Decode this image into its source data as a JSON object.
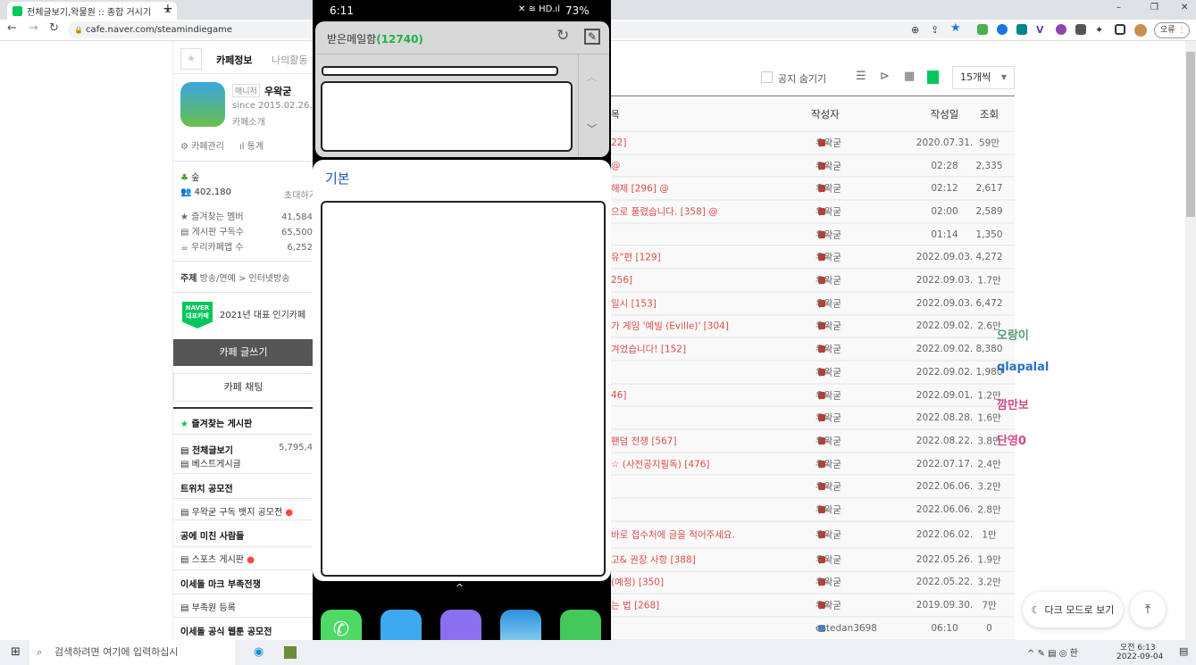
{
  "browser": {
    "tab_title": "전체글보기,왁물원 :: 종합 거시기",
    "new_tab": "+",
    "url": "cafe.naver.com/steamindiegame",
    "profile_label": "오류",
    "window": {
      "min": "–",
      "max": "❐",
      "close": "✕"
    }
  },
  "sidebar": {
    "tab_info": "카페정보",
    "tab_activity": "나의활동",
    "manager_badge": "매니저",
    "manager_name": "우왁굳",
    "since": "since 2015.02.26.",
    "cafe_intro": "카페소개",
    "cafe_manage": "카페관리",
    "stats": "통계",
    "level": "숲",
    "members": "402,180",
    "invite": "초대하기",
    "stats_rows": [
      {
        "label": "즐겨찾는 멤버",
        "value": "41,584"
      },
      {
        "label": "게시판 구독수",
        "value": "65,500"
      },
      {
        "label": "우리카페앱 수",
        "value": "6,252"
      }
    ],
    "topic_label": "주제",
    "topic": "방송/연예 > 인터넷방송",
    "naver_badge": "NAVER 대표카페",
    "award": "2021년 대표 인기카페",
    "write_button": "카페 글쓰기",
    "chat_button": "카페 채팅",
    "fav_boards": "즐겨찾는 게시판",
    "all_posts": "전체글보기",
    "all_posts_count": "5,795,4",
    "best": "베스트게시글",
    "sec1": "트위치 공모전",
    "board1": "우왁굳 구독 뱃지 공모전",
    "sec2": "공에 미친 사람들",
    "board2": "스포츠 게시판",
    "sec3": "이세돌 마크 부족전쟁",
    "board3": "부족원 등록",
    "sec4": "이세돌 공식 웹툰 공모전"
  },
  "toolbar": {
    "hide_notice": "공지 숨기기",
    "per_page": "15개씩"
  },
  "table": {
    "headers": {
      "title": "목",
      "author": "작성자",
      "date": "작성일",
      "views": "조회"
    },
    "rows": [
      {
        "title": "22]",
        "author": "우왁굳",
        "date": "2020.07.31.",
        "views": "59만"
      },
      {
        "title": "@",
        "author": "우왁굳",
        "date": "02:28",
        "views": "2,335"
      },
      {
        "title": "해제 [296] @",
        "author": "우왁굳",
        "date": "02:12",
        "views": "2,617"
      },
      {
        "title": "으로 풀렸습니다. [358] @",
        "author": "우왁굳",
        "date": "02:00",
        "views": "2,589"
      },
      {
        "title": "",
        "author": "우왁굳",
        "date": "01:14",
        "views": "1,350"
      },
      {
        "title": "유\"편 [129]",
        "author": "우왁굳",
        "date": "2022.09.03.",
        "views": "4,272"
      },
      {
        "title": "256]",
        "author": "우왁굳",
        "date": "2022.09.03.",
        "views": "1.7만"
      },
      {
        "title": "일시 [153]",
        "author": "우왁굳",
        "date": "2022.09.03.",
        "views": "6,472"
      },
      {
        "title": "가 게임 '예빌 (Eville)' [304]",
        "author": "우왁굳",
        "date": "2022.09.02.",
        "views": "2.6만"
      },
      {
        "title": "겨었습니다! [152]",
        "author": "우왁굳",
        "date": "2022.09.02.",
        "views": "8,380"
      },
      {
        "title": "",
        "author": "우왁굳",
        "date": "2022.09.02.",
        "views": "1,980"
      },
      {
        "title": "46]",
        "author": "우왁굳",
        "date": "2022.09.01.",
        "views": "1.2만"
      },
      {
        "title": "",
        "author": "우왁굳",
        "date": "2022.08.28.",
        "views": "1.6만"
      },
      {
        "title": "팬덤 전쟁 [567]",
        "author": "우왁굳",
        "date": "2022.08.22.",
        "views": "3.8만"
      },
      {
        "title": "☆ (사전공지필독) [476]",
        "author": "우왁굳",
        "date": "2022.07.17.",
        "views": "2.4만"
      },
      {
        "title": "",
        "author": "우왁굳",
        "date": "2022.06.06.",
        "views": "3.2만"
      },
      {
        "title": "",
        "author": "우왁굳",
        "date": "2022.06.06.",
        "views": "2.8만"
      },
      {
        "title": "바로 접수처에 글을 적어주세요.",
        "author": "우왁굳",
        "date": "2022.06.02.",
        "views": "1만"
      },
      {
        "title": "고& 권장 사항 [388]",
        "author": "우왁굳",
        "date": "2022.05.26.",
        "views": "1.9만"
      },
      {
        "title": "(예정) [350]",
        "author": "우왁굳",
        "date": "2022.05.22.",
        "views": "3.2만"
      },
      {
        "title": "는 법 [268]",
        "author": "우왁굳",
        "date": "2019.09.30.",
        "views": "7만"
      },
      {
        "title": "",
        "author": "estedan3698",
        "date": "06:10",
        "views": "0"
      }
    ]
  },
  "chat_overlay": [
    {
      "name": "오랑이",
      "color": "#5a9a78"
    },
    {
      "name": "qlapalal",
      "color": "#2a6fc9"
    },
    {
      "name": "깜만보",
      "color": "#d04a8a"
    },
    {
      "name": "단영0",
      "color": "#d04a8a"
    }
  ],
  "floating": {
    "dark_mode": "다크 모드로 보기"
  },
  "phone": {
    "time": "6:11",
    "battery": "73%",
    "mail_title": "받은메일함",
    "mail_count": "(12740)",
    "panel_title": "기본"
  },
  "taskbar": {
    "search_placeholder": "검색하려면 여기에 입력하십시",
    "time": "오전 6:13",
    "date": "2022-09-04"
  }
}
